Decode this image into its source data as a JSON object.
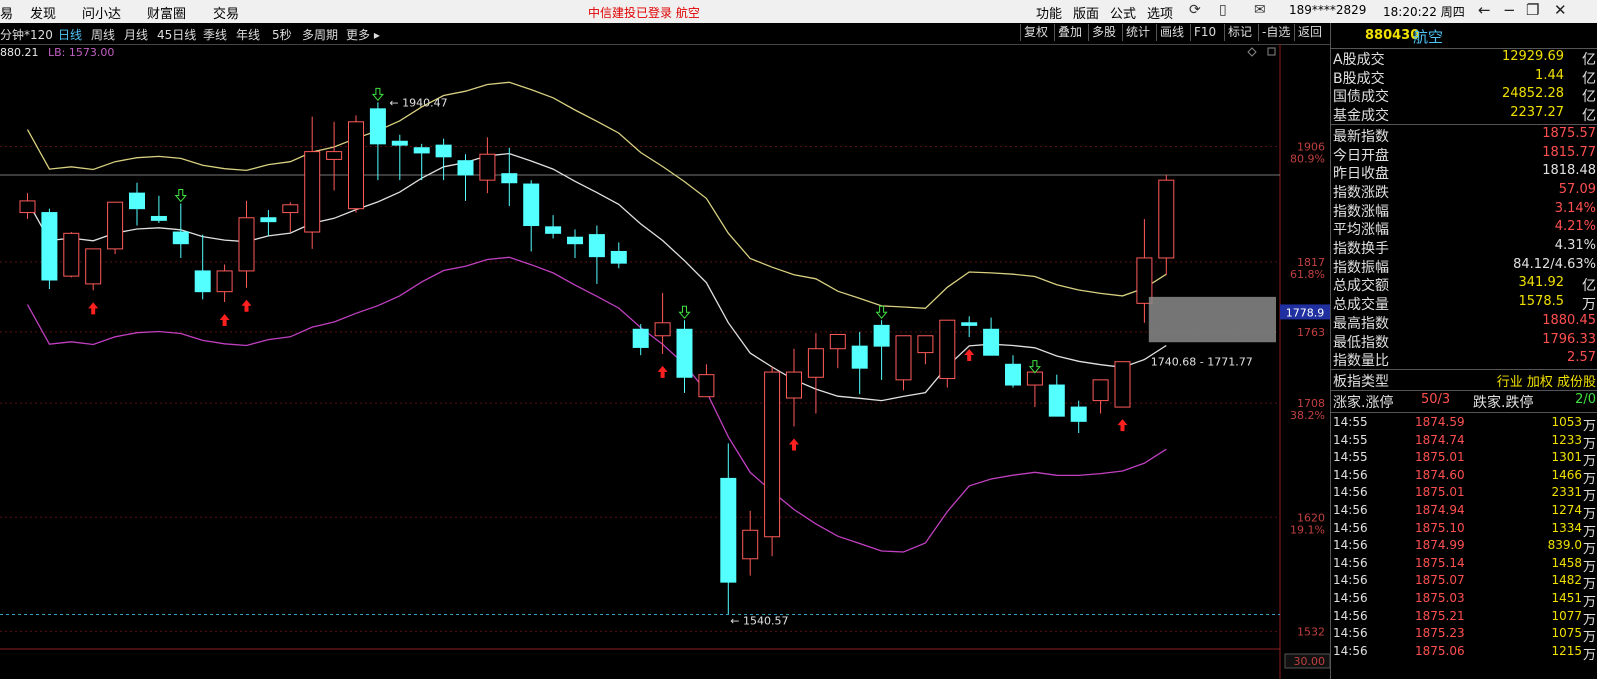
{
  "topbar": {
    "nav": [
      "发现",
      "问小达",
      "财富圈",
      "交易"
    ],
    "nav_cut": "易",
    "login_status": "中信建投已登录  航空",
    "menu": [
      "功能",
      "版面",
      "公式",
      "选项"
    ],
    "user": "189****2829",
    "clock": "18:20:22 周四"
  },
  "periodbar": {
    "periods": [
      "分钟*120",
      "日线",
      "周线",
      "月线",
      "45日线",
      "季线",
      "年线",
      "5秒",
      "多周期",
      "更多 ▸"
    ],
    "active": "日线",
    "tools": [
      "复权",
      "叠加",
      "多股",
      "统计",
      "画线",
      "F10",
      "标记",
      "-自选",
      "返回"
    ]
  },
  "ma_legend": {
    "line1": "880.21",
    "line2": "LB: 1573.00"
  },
  "chart_data": {
    "type": "candlestick",
    "y_range": [
      1530,
      1985
    ],
    "y_ticks": [
      {
        "price": 1906,
        "pct": "80.9%"
      },
      {
        "price": 1817,
        "pct": "61.8%"
      },
      {
        "price": 1763,
        "pct": ""
      },
      {
        "price": 1708,
        "pct": "38.2%"
      },
      {
        "price": 1620,
        "pct": "19.1%"
      },
      {
        "price": 1532,
        "pct": ""
      }
    ],
    "current_price_tag": "1778.9",
    "high_label": "1940.47",
    "low_label": "1540.57",
    "range_label": "1740.68 - 1771.77",
    "volume_axis": "30.00",
    "candles": [
      [
        1855,
        1870,
        1850,
        1864
      ],
      [
        1855,
        1858,
        1796,
        1803
      ],
      [
        1806,
        1840,
        1805,
        1839
      ],
      [
        1800,
        1820,
        1795,
        1827
      ],
      [
        1827,
        1862,
        1823,
        1863
      ],
      [
        1870,
        1878,
        1845,
        1858
      ],
      [
        1852,
        1868,
        1847,
        1849
      ],
      [
        1840,
        1862,
        1820,
        1831
      ],
      [
        1810,
        1838,
        1788,
        1794
      ],
      [
        1794,
        1815,
        1786,
        1810
      ],
      [
        1810,
        1864,
        1797,
        1851
      ],
      [
        1851,
        1857,
        1837,
        1848
      ],
      [
        1855,
        1863,
        1840,
        1861
      ],
      [
        1840,
        1929,
        1827,
        1902
      ],
      [
        1896,
        1925,
        1872,
        1902
      ],
      [
        1858,
        1930,
        1855,
        1925
      ],
      [
        1935,
        1940,
        1880,
        1908
      ],
      [
        1910,
        1915,
        1880,
        1907
      ],
      [
        1905,
        1908,
        1880,
        1901
      ],
      [
        1907,
        1912,
        1880,
        1898
      ],
      [
        1895,
        1900,
        1864,
        1884
      ],
      [
        1880,
        1913,
        1870,
        1900
      ],
      [
        1885,
        1905,
        1860,
        1878
      ],
      [
        1877,
        1880,
        1825,
        1845
      ],
      [
        1844,
        1853,
        1835,
        1839
      ],
      [
        1836,
        1842,
        1820,
        1831
      ],
      [
        1838,
        1845,
        1800,
        1821
      ],
      [
        1825,
        1832,
        1812,
        1816
      ],
      [
        1765,
        1769,
        1745,
        1751
      ],
      [
        1760,
        1793,
        1746,
        1770
      ],
      [
        1765,
        1772,
        1716,
        1728
      ],
      [
        1713,
        1738,
        1713,
        1730
      ],
      [
        1650,
        1677,
        1545,
        1570
      ],
      [
        1588,
        1625,
        1575,
        1610
      ],
      [
        1605,
        1736,
        1590,
        1732
      ],
      [
        1712,
        1750,
        1690,
        1732
      ],
      [
        1728,
        1762,
        1700,
        1750
      ],
      [
        1750,
        1761,
        1735,
        1761
      ],
      [
        1752,
        1763,
        1715,
        1735
      ],
      [
        1768,
        1772,
        1726,
        1752
      ],
      [
        1726,
        1755,
        1718,
        1760
      ],
      [
        1747,
        1755,
        1738,
        1760
      ],
      [
        1727,
        1770,
        1720,
        1772
      ],
      [
        1770,
        1775,
        1759,
        1768
      ],
      [
        1765,
        1774,
        1745,
        1745
      ],
      [
        1738,
        1745,
        1720,
        1722
      ],
      [
        1722,
        1730,
        1705,
        1732
      ],
      [
        1722,
        1730,
        1700,
        1698
      ],
      [
        1705,
        1710,
        1685,
        1694
      ],
      [
        1710,
        1726,
        1700,
        1726
      ],
      [
        1705,
        1740,
        1705,
        1740
      ],
      [
        1785,
        1850,
        1770,
        1820
      ],
      [
        1820,
        1884,
        1807,
        1880
      ]
    ],
    "up_arrow_candles": [
      3,
      9,
      10,
      29,
      35,
      43,
      50
    ],
    "down_arrow_candles": [
      7,
      16,
      30,
      39,
      46
    ]
  },
  "panel": {
    "code": "880430",
    "name": "航空",
    "turnover": [
      {
        "k": "A股成交",
        "v": "12929.69",
        "u": "亿",
        "c": "#f0e000"
      },
      {
        "k": "B股成交",
        "v": "1.44",
        "u": "亿",
        "c": "#f0e000"
      },
      {
        "k": "国债成交",
        "v": "24852.28",
        "u": "亿",
        "c": "#f0e000"
      },
      {
        "k": "基金成交",
        "v": "2237.27",
        "u": "亿",
        "c": "#f0e000"
      }
    ],
    "quotes": [
      {
        "k": "最新指数",
        "v": "1875.57",
        "c": "#ff5050"
      },
      {
        "k": "今日开盘",
        "v": "1815.77",
        "c": "#ff5050"
      },
      {
        "k": "昨日收盘",
        "v": "1818.48",
        "c": "#e0e0e0"
      },
      {
        "k": "指数涨跌",
        "v": "57.09",
        "c": "#ff5050"
      },
      {
        "k": "指数涨幅",
        "v": "3.14%",
        "c": "#ff5050"
      },
      {
        "k": "平均涨幅",
        "v": "4.21%",
        "c": "#ff5050"
      },
      {
        "k": "指数换手",
        "v": "4.31%",
        "c": "#e0e0e0"
      },
      {
        "k": "指数振幅",
        "v": "84.12/4.63%",
        "c": "#e0e0e0"
      },
      {
        "k": "总成交额",
        "v": "341.92",
        "u": "亿",
        "c": "#f0e000"
      },
      {
        "k": "总成交量",
        "v": "1578.5",
        "u": "万",
        "c": "#f0e000"
      },
      {
        "k": "最高指数",
        "v": "1880.45",
        "c": "#ff5050"
      },
      {
        "k": "最低指数",
        "v": "1796.33",
        "c": "#ff5050"
      },
      {
        "k": "指数量比",
        "v": "2.57",
        "c": "#ff5050"
      }
    ],
    "board_type": {
      "k": "板指类型",
      "v": "行业 加权 成份股"
    },
    "breadth": {
      "k1": "涨家.涨停",
      "v1": "50/3",
      "k2": "跌家.跌停",
      "v2": "2/0"
    },
    "ticks": [
      {
        "t": "14:55",
        "p": "1874.59",
        "v": "1053",
        "u": "万"
      },
      {
        "t": "14:55",
        "p": "1874.74",
        "v": "1233",
        "u": "万"
      },
      {
        "t": "14:55",
        "p": "1875.01",
        "v": "1301",
        "u": "万"
      },
      {
        "t": "14:56",
        "p": "1874.60",
        "v": "1466",
        "u": "万"
      },
      {
        "t": "14:56",
        "p": "1875.01",
        "v": "2331",
        "u": "万"
      },
      {
        "t": "14:56",
        "p": "1874.94",
        "v": "1274",
        "u": "万"
      },
      {
        "t": "14:56",
        "p": "1875.10",
        "v": "1334",
        "u": "万"
      },
      {
        "t": "14:56",
        "p": "1874.99",
        "v": "839.0",
        "u": "万"
      },
      {
        "t": "14:56",
        "p": "1875.14",
        "v": "1458",
        "u": "万"
      },
      {
        "t": "14:56",
        "p": "1875.07",
        "v": "1482",
        "u": "万"
      },
      {
        "t": "14:56",
        "p": "1875.03",
        "v": "1451",
        "u": "万"
      },
      {
        "t": "14:56",
        "p": "1875.21",
        "v": "1077",
        "u": "万"
      },
      {
        "t": "14:56",
        "p": "1875.23",
        "v": "1075",
        "u": "万"
      },
      {
        "t": "14:56",
        "p": "1875.06",
        "v": "1215",
        "u": "万"
      }
    ]
  }
}
